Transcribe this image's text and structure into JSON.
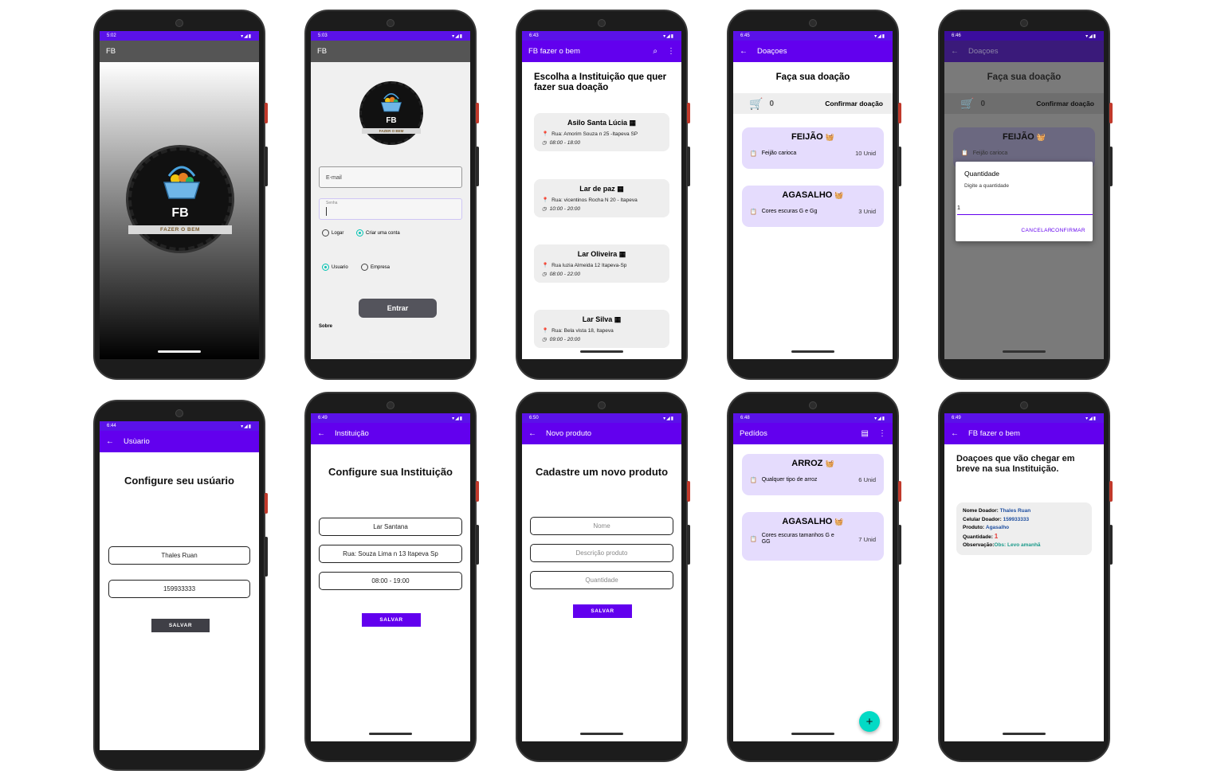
{
  "colors": {
    "primary": "#6200ee",
    "teal": "#03dac5",
    "card_lilac": "#e5dcfd",
    "dark_button": "#3f3f46"
  },
  "p1": {
    "time": "5:02",
    "signal": "▾◢▮",
    "title": "FB",
    "logo_letters": "FB",
    "logo_text": "FAZER O BEM"
  },
  "p2": {
    "time": "5:03",
    "signal": "▾◢▮",
    "title": "FB",
    "logo_letters": "FB",
    "logo_text": "FAZER O BEM",
    "email_placeholder": "E-mail",
    "senha_label": "Senha",
    "radio_logar": "Logar",
    "radio_criar": "Criar uma conta",
    "radio_usuario": "Usuario",
    "radio_empresa": "Empresa",
    "entrar": "Entrar",
    "sobre": "Sobre"
  },
  "p3": {
    "time": "6:43",
    "signal": "▾◢▮",
    "title": "FB fazer o bem",
    "heading": "Escolha a Instituição que quer fazer sua doação",
    "items": [
      {
        "name": "Asilo Santa Lúcia",
        "addr": "Rua: Amorim Souza n 25 -Itapeva SP",
        "hours": "08:00 - 18:00"
      },
      {
        "name": "Lar de paz",
        "addr": "Rua: vicentinos Rocha N 20 - Itapeva",
        "hours": "10:00 - 20:00"
      },
      {
        "name": "Lar Oliveira",
        "addr": "Rua luzia Almeida 12 Itapeva-Sp",
        "hours": "08:00 - 22:00"
      },
      {
        "name": "Lar Silva",
        "addr": "Rua: Bela vista 18, Itapeva",
        "hours": "09:00 - 20:00"
      }
    ]
  },
  "p4": {
    "time": "6:45",
    "signal": "▾◢▮",
    "title": "Doaçoes",
    "heading": "Faça sua doação",
    "cart_count": "0",
    "confirm": "Confirmar doação",
    "items": [
      {
        "name": "FEIJÃO",
        "desc": "Feijão carioca",
        "qty": "10",
        "unit": "Unid"
      },
      {
        "name": "AGASALHO",
        "desc": "Cores escuras G e Gg",
        "qty": "3",
        "unit": "Unid"
      }
    ]
  },
  "p5": {
    "time": "6:46",
    "signal": "▾◢▮",
    "title": "Doaçoes",
    "heading": "Faça sua doação",
    "cart_count": "0",
    "confirm": "Confirmar doação",
    "card_name": "FEIJÃO",
    "card_desc": "Feijão carioca",
    "dialog": {
      "title": "Quantidade",
      "message": "Digite a quantidade",
      "value": "1",
      "cancel": "CANCELAR",
      "ok": "CONFIRMAR"
    }
  },
  "p6": {
    "time": "6:44",
    "signal": "▾◢▮",
    "title": "Usùario",
    "heading": "Configure seu usúario",
    "name": "Thales Ruan",
    "phone": "159933333",
    "save": "SALVAR"
  },
  "p7": {
    "time": "6:49",
    "signal": "▾◢▮",
    "title": "Instituição",
    "heading": "Configure sua Instituição",
    "name": "Lar Santana",
    "addr": "Rua: Souza Lima n 13 Itapeva Sp",
    "hours": "08:00 - 19:00",
    "save": "SALVAR"
  },
  "p8": {
    "time": "6:50",
    "signal": "▾◢▮",
    "title": "Novo produto",
    "heading": "Cadastre um novo produto",
    "nome": "Nome",
    "descricao": "Descrição produto",
    "quantidade": "Quantidade",
    "save": "SALVAR"
  },
  "p9": {
    "time": "6:48",
    "signal": "▾◢▮",
    "title": "Pedídos",
    "fab": "+",
    "items": [
      {
        "name": "ARROZ",
        "desc": "Qualquer tipo de arroz",
        "qty": "6",
        "unit": "Unid"
      },
      {
        "name": "AGASALHO",
        "desc": "Cores escuras tamanhos G e GG",
        "qty": "7",
        "unit": "Unid"
      }
    ]
  },
  "p10": {
    "time": "6:49",
    "signal": "▾◢▮",
    "title": "FB fazer o bem",
    "heading": "Doaçoes que vão chegar em breve na sua Instituição.",
    "donation": {
      "nome_label": "Nome Doador:",
      "nome": "Thales Ruan",
      "cel_label": "Celular Doador:",
      "cel": "159933333",
      "prod_label": "Produto:",
      "prod": "Agasalho",
      "qtd_label": "Quantidade:",
      "qtd": "1",
      "obs_label": "Observação:",
      "obs": "Obs: Levo amanhã"
    }
  }
}
